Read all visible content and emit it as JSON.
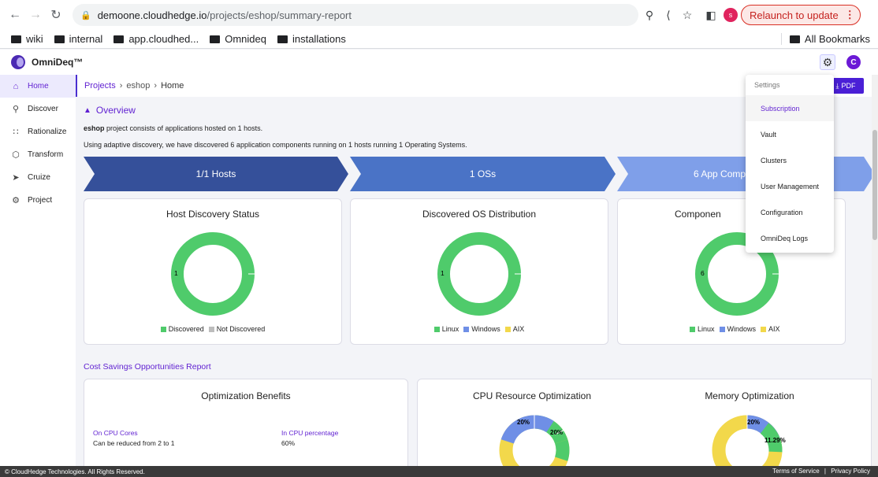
{
  "browser": {
    "url_host": "demoone.cloudhedge.io",
    "url_path": "/projects/eshop/summary-report",
    "profile_initial": "s",
    "relaunch_label": "Relaunch to update"
  },
  "bookmarks": {
    "items": [
      "wiki",
      "internal",
      "app.cloudhed...",
      "Omnideq",
      "installations"
    ],
    "all_label": "All Bookmarks"
  },
  "app": {
    "brand": "OmniDeq™",
    "avatar_initial": "C",
    "accent": "#5f1fd1"
  },
  "sidebar": {
    "items": [
      {
        "label": "Home",
        "icon": "home-icon"
      },
      {
        "label": "Discover",
        "icon": "search-icon"
      },
      {
        "label": "Rationalize",
        "icon": "nodes-icon"
      },
      {
        "label": "Transform",
        "icon": "cube-icon"
      },
      {
        "label": "Cruize",
        "icon": "rocket-icon"
      },
      {
        "label": "Project",
        "icon": "settings-icon"
      }
    ]
  },
  "breadcrumb": {
    "projects": "Projects",
    "project": "eshop",
    "current": "Home"
  },
  "pdf_label": "PDF",
  "overview": {
    "title": "Overview",
    "line1_bold": "eshop",
    "line1_rest": " project consists of applications hosted on 1 hosts.",
    "line2": "Using adaptive discovery, we have discovered 6 application components running on 1 hosts running 1 Operating Systems."
  },
  "banner": {
    "hosts": "1/1 Hosts",
    "oss": "1 OSs",
    "components": "6 App Comp"
  },
  "cards": {
    "host": {
      "title": "Host Discovery Status",
      "center_value": "1",
      "legend": [
        "Discovered",
        "Not Discovered"
      ]
    },
    "os": {
      "title": "Discovered OS Distribution",
      "center_value": "1",
      "legend": [
        "Linux",
        "Windows",
        "AIX"
      ]
    },
    "comp": {
      "title": "Componen",
      "center_value": "6",
      "legend": [
        "Linux",
        "Windows",
        "AIX"
      ]
    }
  },
  "colors": {
    "green": "#4fcb6b",
    "grey": "#bdbdbd",
    "blue": "#6f8fe6",
    "yellow": "#f2d84b",
    "arrow1": "#35509a",
    "arrow2": "#4a73c6",
    "arrow3": "#7f9fe9"
  },
  "cost": {
    "link": "Cost Savings Opportunities Report",
    "opt_title": "Optimization Benefits",
    "cpu_cores_label": "On CPU Cores",
    "cpu_cores_value": "Can be reduced from 2 to 1",
    "cpu_pct_label": "In CPU percentage",
    "cpu_pct_value": "60%",
    "cpu_title": "CPU Resource Optimization",
    "cpu_labels": [
      "20%",
      "20%"
    ],
    "mem_title": "Memory Optimization",
    "mem_labels": [
      "20%",
      "11.29%"
    ]
  },
  "settings_menu": {
    "header": "Settings",
    "items": [
      "Subscription",
      "Vault",
      "Clusters",
      "User Management",
      "Configuration",
      "OmniDeq Logs"
    ]
  },
  "footer": {
    "copyright": "© CloudHedge Technologies. All Rights Reserved.",
    "terms": "Terms of Service",
    "privacy": "Privacy Policy"
  }
}
